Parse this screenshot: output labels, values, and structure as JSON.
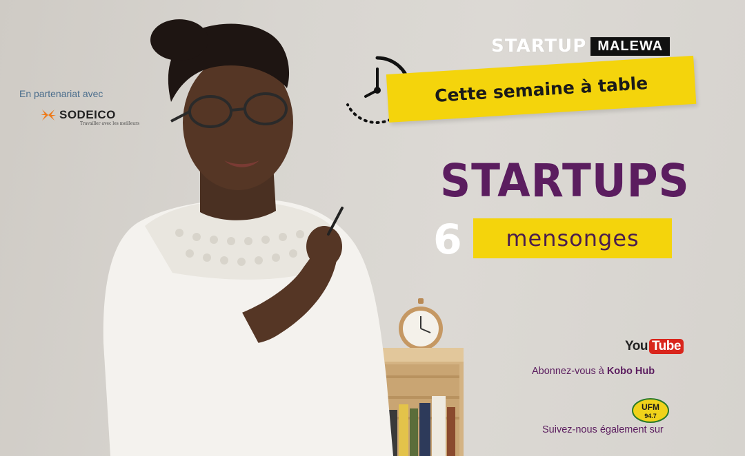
{
  "partner": {
    "label": "En partenariat avec",
    "logo_name": "SODEICO",
    "logo_tagline": "Travailler avec les meilleurs"
  },
  "brand": {
    "part1": "STARTUP",
    "part2": "MALEWA"
  },
  "banner": {
    "text": "Cette semaine à table"
  },
  "headline": {
    "title": "STARTUPS",
    "number": "6",
    "subtitle": "mensonges"
  },
  "youtube": {
    "you": "You",
    "tube": "Tube",
    "subscribe_prefix": "Abonnez-vous à ",
    "subscribe_channel": "Kobo Hub"
  },
  "radio": {
    "logo_text": "UFM",
    "frequency": "94.7",
    "follow_text": "Suivez-nous également sur"
  },
  "colors": {
    "accent_yellow": "#f4d40c",
    "accent_purple": "#5b1d5f",
    "youtube_red": "#d9251c"
  },
  "icons": [
    "clock-icon",
    "sodeico-star-icon",
    "ufm-logo-icon"
  ]
}
